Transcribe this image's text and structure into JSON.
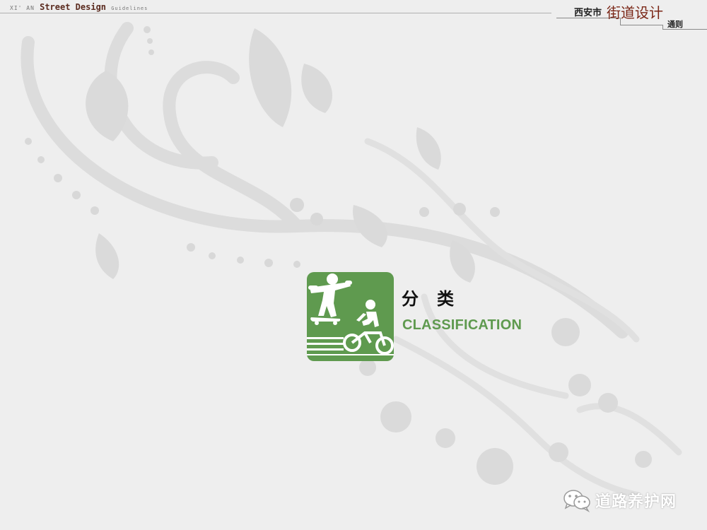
{
  "header": {
    "city_prefix": "XI' AN",
    "doc_title_en": "Street Design",
    "doc_subtitle_en": "Guidelines",
    "city_cn": "西安市",
    "title_cn": "街道设计",
    "subtitle_cn": "通则"
  },
  "section": {
    "title_cn": "分类",
    "title_en": "CLASSIFICATION",
    "icon": "skateboarder-and-cyclist-icon",
    "icon_color": "#5f9a4f"
  },
  "watermark": {
    "text": "道路养护网",
    "icon": "wechat-icon"
  },
  "colors": {
    "background": "#eeeeee",
    "accent_green": "#5f9a4f",
    "title_red": "#7a2616"
  }
}
